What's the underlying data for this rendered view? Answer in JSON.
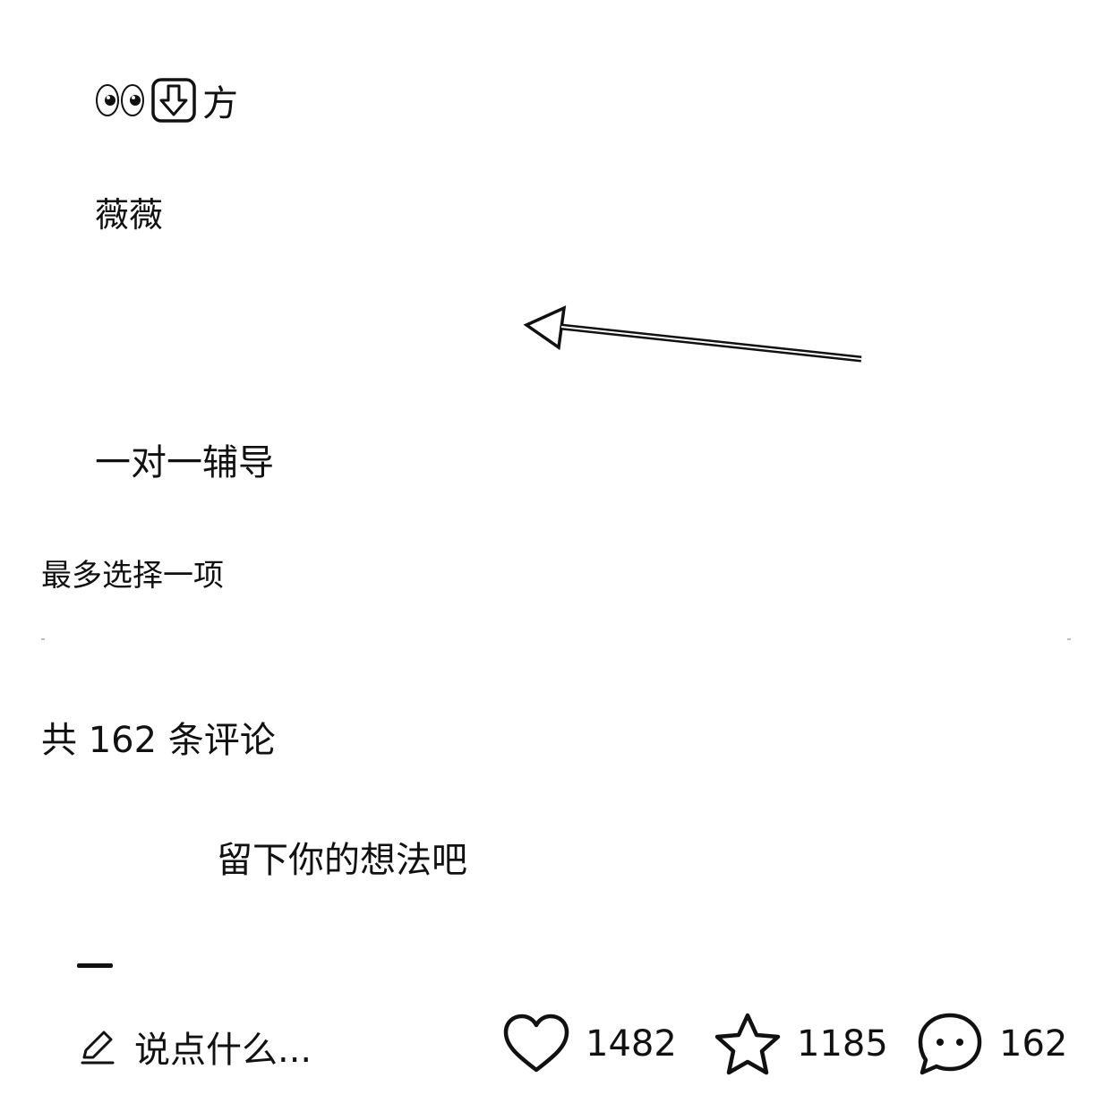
{
  "post": {
    "line1_text": "方",
    "line2_text": "薇薇",
    "line3_text": "一对一辅导"
  },
  "poll": {
    "hint": "最多选择一项"
  },
  "comments": {
    "count_label": "共 162 条评论",
    "prompt": "留下你的想法吧"
  },
  "footer": {
    "input_placeholder": "说点什么...",
    "likes": "1482",
    "favorites": "1185",
    "comments": "162"
  }
}
